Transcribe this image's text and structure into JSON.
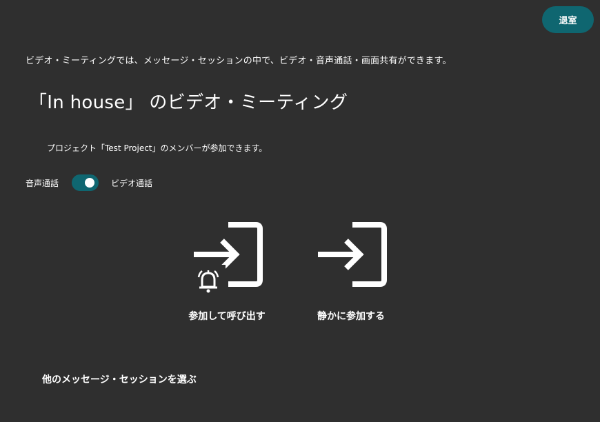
{
  "header": {
    "leave_label": "退室"
  },
  "intro_text": "ビデオ・ミーティングでは、メッセージ・セッションの中で、ビデオ・音声通話・画面共有ができます。",
  "title": "「In house」 のビデオ・ミーティング",
  "project_note": "プロジェクト「Test Project」のメンバーが参加できます。",
  "mode": {
    "audio_label": "音声通話",
    "video_label": "ビデオ通話",
    "selected": "video"
  },
  "actions": [
    {
      "label": "参加して呼び出す",
      "icon": "enter-with-bell-icon"
    },
    {
      "label": "静かに参加する",
      "icon": "enter-icon"
    }
  ],
  "other_session_link": "他のメッセージ・セッションを選ぶ",
  "colors": {
    "background": "#2f2f2f",
    "accent": "#0f6670",
    "text": "#ffffff"
  }
}
